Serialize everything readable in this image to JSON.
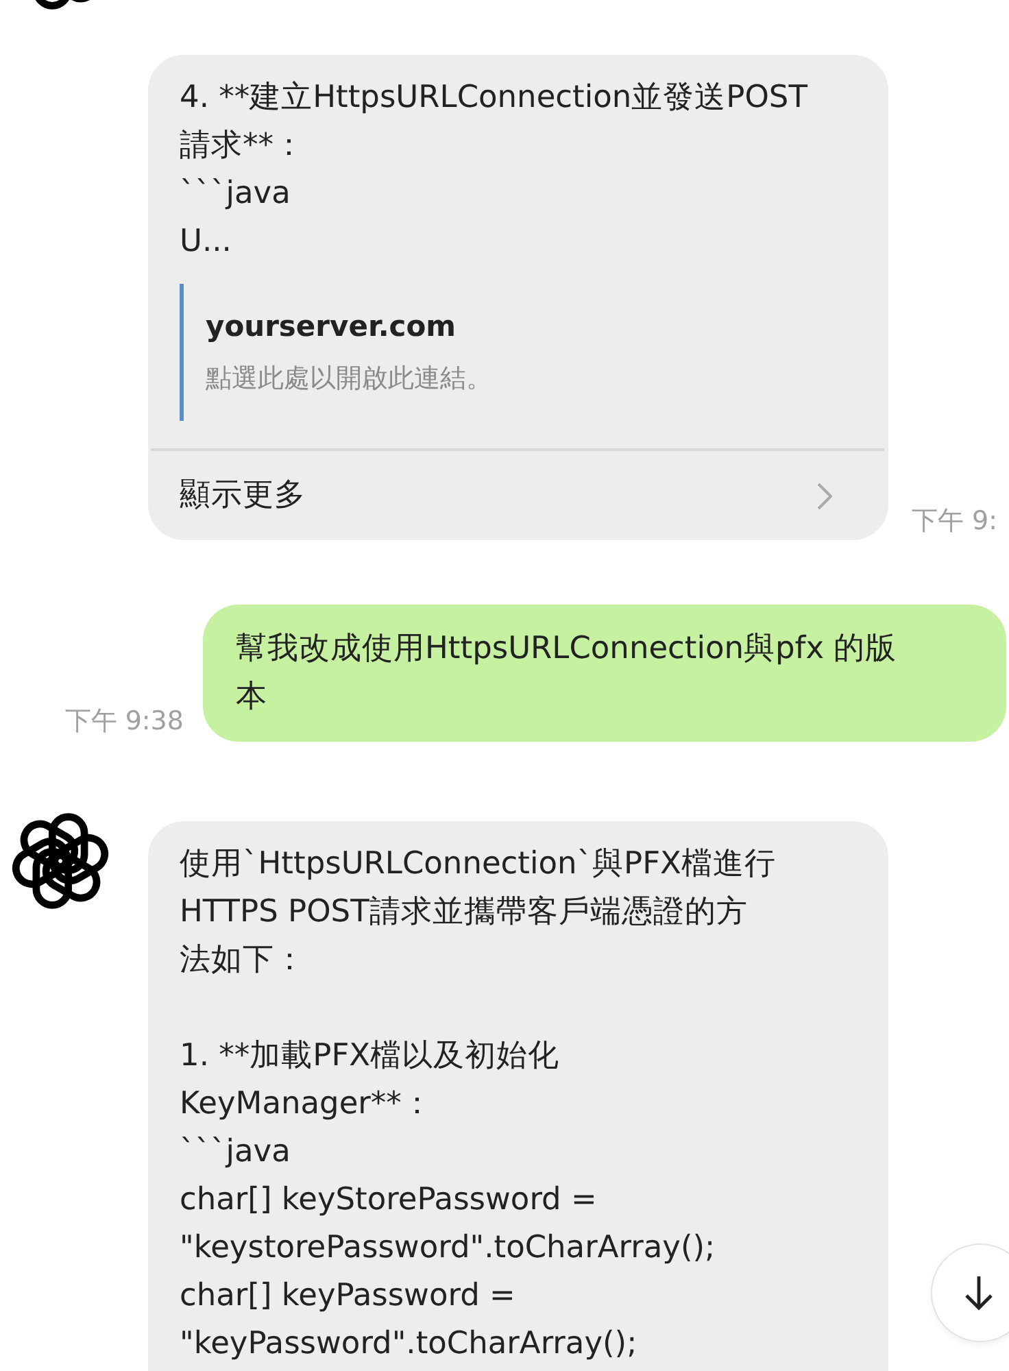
{
  "messages": [
    {
      "kind": "bot",
      "avatar": false,
      "paragraphs": [
        [
          "4. **建立HttpsURLConnection並發送POST",
          "請求**：",
          "```java",
          "U..."
        ]
      ],
      "link": {
        "title": "yourserver.com",
        "subtitle": "點選此處以開啟此連結。"
      },
      "more": "顯示更多",
      "time": "下午 9:"
    },
    {
      "kind": "user",
      "paragraphs": [
        [
          "幫我改成使用HttpsURLConnection與pfx 的版",
          "本"
        ]
      ],
      "time": "下午 9:38"
    },
    {
      "kind": "bot",
      "avatar": true,
      "paragraphs": [
        [
          "使用`HttpsURLConnection`與PFX檔進行",
          "HTTPS POST請求並攜帶客戶端憑證的方",
          "法如下："
        ],
        [
          "1. **加載PFX檔以及初始化",
          "KeyManager**：",
          "```java",
          "char[] keyStorePassword =",
          "\"keystorePassword\".toCharArray();",
          "char[] keyPassword =",
          "\"keyPassword\".toCharArray();"
        ]
      ]
    }
  ]
}
